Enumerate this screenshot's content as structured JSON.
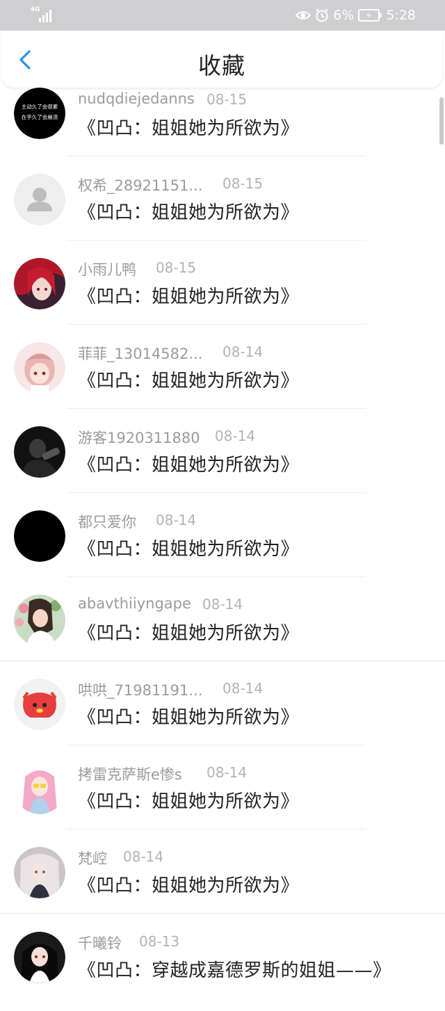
{
  "status_bar": {
    "network": "4G",
    "battery": "6%",
    "time": "5:28",
    "icons": [
      "signal-icon",
      "eye-icon",
      "alarm-icon",
      "battery-icon"
    ]
  },
  "header": {
    "title": "收藏",
    "back_icon": "chevron-left-icon"
  },
  "items": [
    {
      "name": "nudqdiejedanns",
      "date": "08-15",
      "book": "《凹凸：姐姐她为所欲为》"
    },
    {
      "name": "权希_28921151...",
      "date": "08-15",
      "book": "《凹凸：姐姐她为所欲为》"
    },
    {
      "name": "小雨儿鸭",
      "date": "08-15",
      "book": "《凹凸：姐姐她为所欲为》"
    },
    {
      "name": "菲菲_13014582...",
      "date": "08-14",
      "book": "《凹凸：姐姐她为所欲为》"
    },
    {
      "name": "游客1920311880",
      "date": "08-14",
      "book": "《凹凸：姐姐她为所欲为》"
    },
    {
      "name": "都只爱你",
      "date": "08-14",
      "book": "《凹凸：姐姐她为所欲为》"
    },
    {
      "name": "abavthiiyngape",
      "date": "08-14",
      "book": "《凹凸：姐姐她为所欲为》"
    },
    {
      "name": "哄哄_71981191...",
      "date": "08-14",
      "book": "《凹凸：姐姐她为所欲为》"
    },
    {
      "name": "拷雷克萨斯e惨s",
      "date": "08-14",
      "book": "《凹凸：姐姐她为所欲为》"
    },
    {
      "name": "梵崆",
      "date": "08-14",
      "book": "《凹凸：姐姐她为所欲为》"
    },
    {
      "name": "千曦铃",
      "date": "08-13",
      "book": "《凹凸：穿越成嘉德罗斯的姐姐——》"
    }
  ],
  "avatar_text": [
    "主动久了会很累",
    "在乎久了会崩溃"
  ],
  "colors": {
    "accent": "#2f8fe8",
    "status_bar": "#cfcfd1"
  }
}
